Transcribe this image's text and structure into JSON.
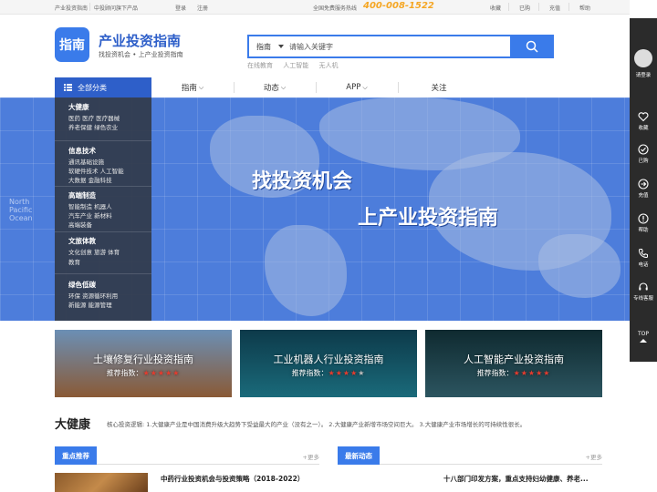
{
  "topbar": {
    "site_link": "产业投资指南",
    "brand_link": "中投顾问旗下产品",
    "login": "登录",
    "register": "注册",
    "hotline_label": "全国免费服务热线",
    "hotline_number": "400-008-1522",
    "favorite": "收藏",
    "purchased": "已购",
    "recharge": "充值",
    "help": "帮助"
  },
  "header": {
    "logo_text": "指南",
    "title": "产业投资指南",
    "subtitle": "找投资机会 • 上产业投资指南"
  },
  "search": {
    "category": "指南",
    "placeholder": "请输入关键字",
    "hotwords": [
      "在线教育",
      "人工智能",
      "无人机"
    ]
  },
  "nav": {
    "all_categories": "全部分类",
    "items": [
      {
        "label": "指南",
        "dropdown": true
      },
      {
        "label": "动态",
        "dropdown": true
      },
      {
        "label": "APP",
        "dropdown": true
      },
      {
        "label": "关注",
        "dropdown": false
      }
    ]
  },
  "categories": [
    {
      "title": "大健康",
      "lines": [
        "医药 医疗 医疗器械",
        "养老保健 绿色农业"
      ]
    },
    {
      "title": "信息技术",
      "lines": [
        "通讯基础设施",
        "软硬件技术 人工智能",
        "大数据 金融科技"
      ]
    },
    {
      "title": "高端制造",
      "lines": [
        "智能制造 机器人",
        "汽车产业 新材料",
        "高端装备"
      ]
    },
    {
      "title": "文旅体教",
      "lines": [
        "文化创意 旅游 体育",
        "教育"
      ]
    },
    {
      "title": "绿色低碳",
      "lines": [
        "环保 资源循环利用",
        "新能源 能源管理"
      ]
    }
  ],
  "banner": {
    "headline1": "找投资机会",
    "headline2": "上产业投资指南",
    "map_caption": "North\nPacific\nOcean"
  },
  "cards": [
    {
      "title": "土壤修复行业投资指南",
      "rating_label": "推荐指数：",
      "rating": 5,
      "rating_max": 5,
      "bg1": "#6b8fb5",
      "bg2": "#8a5a36"
    },
    {
      "title": "工业机器人行业投资指南",
      "rating_label": "推荐指数：",
      "rating": 4,
      "rating_max": 5,
      "bg1": "#0d3a4a",
      "bg2": "#1a6a7a"
    },
    {
      "title": "人工智能产业投资指南",
      "rating_label": "推荐指数：",
      "rating": 5,
      "rating_max": 5,
      "bg1": "#0f2a30",
      "bg2": "#2c5560"
    }
  ],
  "section": {
    "title": "大健康",
    "description": "核心投资逻辑: 1.大健康产业是中国消费升级大趋势下受益最大的产业（没有之一）。 2.大健康产业新增市场空间巨大。 3.大健康产业市场增长的可持续性很长。"
  },
  "featured": {
    "tab": "重点推荐",
    "more": "+更多",
    "item": "中药行业投资机会与投资策略（2018-2022）"
  },
  "latest": {
    "tab": "最新动态",
    "more": "+更多",
    "item": "十八部门印发方案，重点支持妇幼健康、养老..."
  },
  "sidebar": {
    "login": "请登录",
    "items": [
      "收藏",
      "已购",
      "充值",
      "帮助",
      "电话",
      "专线客服"
    ],
    "top": "TOP"
  },
  "colors": {
    "brand": "#3a7bea",
    "nav_dark": "#2e5fc9",
    "hotline": "#f5a623",
    "star": "#e63b2e"
  }
}
